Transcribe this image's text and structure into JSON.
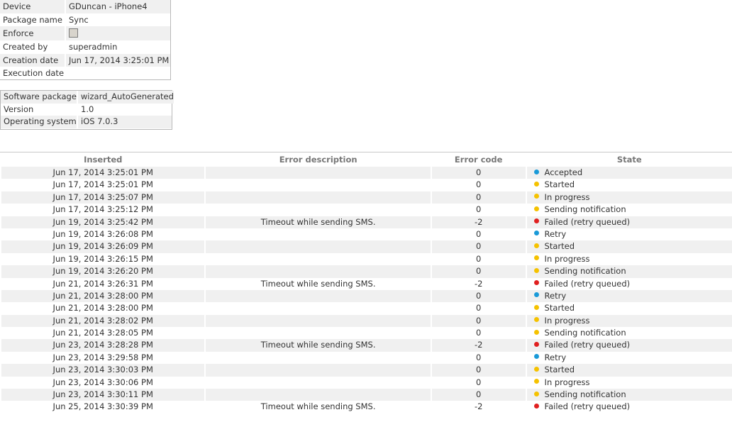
{
  "device_panel": {
    "rows": [
      {
        "label": "Device",
        "value": "GDuncan - iPhone4"
      },
      {
        "label": "Package name",
        "value": "Sync"
      },
      {
        "label": "Enforce",
        "value": ""
      },
      {
        "label": "Created by",
        "value": "superadmin"
      },
      {
        "label": "Creation date",
        "value": "Jun 17, 2014 3:25:01 PM"
      },
      {
        "label": "Execution date",
        "value": ""
      }
    ],
    "enforce_checked": false
  },
  "software_panel": {
    "rows": [
      {
        "label": "Software package",
        "value": "wizard_AutoGenerated"
      },
      {
        "label": "Version",
        "value": "1.0"
      },
      {
        "label": "Operating system",
        "value": "iOS 7.0.3"
      }
    ]
  },
  "history": {
    "headers": {
      "inserted": "Inserted",
      "error_description": "Error description",
      "error_code": "Error code",
      "state": "State"
    },
    "status_colors": {
      "blue": "#1a9ad8",
      "yellow": "#f5c200",
      "red": "#e02020"
    },
    "rows": [
      {
        "inserted": "Jun 17, 2014 3:25:01 PM",
        "error_description": "",
        "error_code": "0",
        "state": "Accepted",
        "status": "blue"
      },
      {
        "inserted": "Jun 17, 2014 3:25:01 PM",
        "error_description": "",
        "error_code": "0",
        "state": "Started",
        "status": "yellow"
      },
      {
        "inserted": "Jun 17, 2014 3:25:07 PM",
        "error_description": "",
        "error_code": "0",
        "state": "In progress",
        "status": "yellow"
      },
      {
        "inserted": "Jun 17, 2014 3:25:12 PM",
        "error_description": "",
        "error_code": "0",
        "state": "Sending notification",
        "status": "yellow"
      },
      {
        "inserted": "Jun 19, 2014 3:25:42 PM",
        "error_description": "Timeout while sending SMS.",
        "error_code": "-2",
        "state": "Failed (retry queued)",
        "status": "red"
      },
      {
        "inserted": "Jun 19, 2014 3:26:08 PM",
        "error_description": "",
        "error_code": "0",
        "state": "Retry",
        "status": "blue"
      },
      {
        "inserted": "Jun 19, 2014 3:26:09 PM",
        "error_description": "",
        "error_code": "0",
        "state": "Started",
        "status": "yellow"
      },
      {
        "inserted": "Jun 19, 2014 3:26:15 PM",
        "error_description": "",
        "error_code": "0",
        "state": "In progress",
        "status": "yellow"
      },
      {
        "inserted": "Jun 19, 2014 3:26:20 PM",
        "error_description": "",
        "error_code": "0",
        "state": "Sending notification",
        "status": "yellow"
      },
      {
        "inserted": "Jun 21, 2014 3:26:31 PM",
        "error_description": "Timeout while sending SMS.",
        "error_code": "-2",
        "state": "Failed (retry queued)",
        "status": "red"
      },
      {
        "inserted": "Jun 21, 2014 3:28:00 PM",
        "error_description": "",
        "error_code": "0",
        "state": "Retry",
        "status": "blue"
      },
      {
        "inserted": "Jun 21, 2014 3:28:00 PM",
        "error_description": "",
        "error_code": "0",
        "state": "Started",
        "status": "yellow"
      },
      {
        "inserted": "Jun 21, 2014 3:28:02 PM",
        "error_description": "",
        "error_code": "0",
        "state": "In progress",
        "status": "yellow"
      },
      {
        "inserted": "Jun 21, 2014 3:28:05 PM",
        "error_description": "",
        "error_code": "0",
        "state": "Sending notification",
        "status": "yellow"
      },
      {
        "inserted": "Jun 23, 2014 3:28:28 PM",
        "error_description": "Timeout while sending SMS.",
        "error_code": "-2",
        "state": "Failed (retry queued)",
        "status": "red"
      },
      {
        "inserted": "Jun 23, 2014 3:29:58 PM",
        "error_description": "",
        "error_code": "0",
        "state": "Retry",
        "status": "blue"
      },
      {
        "inserted": "Jun 23, 2014 3:30:03 PM",
        "error_description": "",
        "error_code": "0",
        "state": "Started",
        "status": "yellow"
      },
      {
        "inserted": "Jun 23, 2014 3:30:06 PM",
        "error_description": "",
        "error_code": "0",
        "state": "In progress",
        "status": "yellow"
      },
      {
        "inserted": "Jun 23, 2014 3:30:11 PM",
        "error_description": "",
        "error_code": "0",
        "state": "Sending notification",
        "status": "yellow"
      },
      {
        "inserted": "Jun 25, 2014 3:30:39 PM",
        "error_description": "Timeout while sending SMS.",
        "error_code": "-2",
        "state": "Failed (retry queued)",
        "status": "red"
      }
    ]
  }
}
